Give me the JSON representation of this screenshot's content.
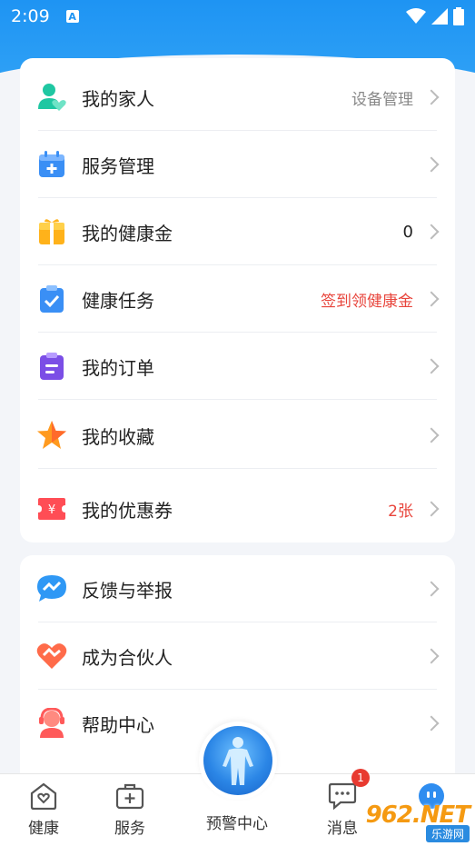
{
  "status_bar": {
    "time": "2:09",
    "a_icon": "A"
  },
  "menu_primary": [
    {
      "label": "我的家人",
      "extra": "设备管理",
      "icon": "family-icon"
    },
    {
      "label": "服务管理",
      "extra": "",
      "icon": "calendar-plus-icon"
    },
    {
      "label": "我的健康金",
      "extra": "0",
      "icon": "gift-icon"
    },
    {
      "label": "健康任务",
      "extra": "签到领健康金",
      "icon": "clipboard-check-icon"
    },
    {
      "label": "我的订单",
      "extra": "",
      "icon": "order-icon"
    },
    {
      "label": "我的收藏",
      "extra": "",
      "icon": "star-icon"
    },
    {
      "label": "我的优惠券",
      "extra": "2张",
      "icon": "coupon-icon"
    }
  ],
  "menu_secondary": [
    {
      "label": "反馈与举报",
      "icon": "feedback-icon"
    },
    {
      "label": "成为合伙人",
      "icon": "partner-icon"
    },
    {
      "label": "帮助中心",
      "icon": "help-icon"
    }
  ],
  "tabbar": {
    "health": "健康",
    "service": "服务",
    "warning": "预警中心",
    "message": "消息",
    "message_badge": "1",
    "mine": ""
  },
  "watermark": {
    "brand": "962.NET",
    "sub": "乐游网"
  },
  "colors": {
    "primary": "#1e94f3",
    "red": "#e8453c"
  }
}
